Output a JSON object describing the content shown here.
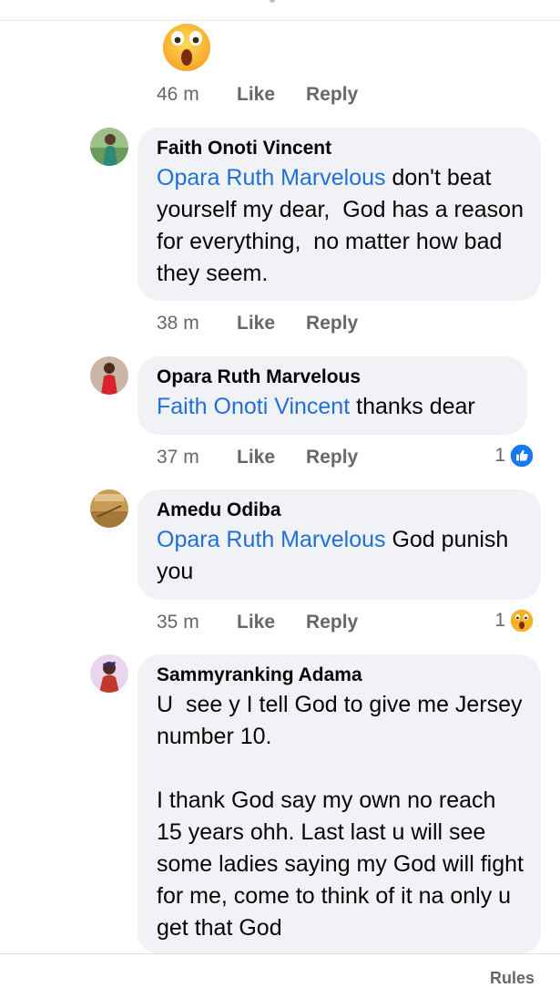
{
  "comments": [
    {
      "time": "46 m",
      "like": "Like",
      "reply": "Reply"
    },
    {
      "author": "Faith Onoti Vincent",
      "mention": "Opara Ruth Marvelous",
      "text": " don't beat yourself my dear,  God has a reason for everything,  no matter how bad they seem.",
      "time": "38 m",
      "like": "Like",
      "reply": "Reply"
    },
    {
      "author": "Opara Ruth Marvelous",
      "mention": "Faith Onoti Vincent",
      "text": " thanks dear",
      "time": "37 m",
      "like": "Like",
      "reply": "Reply",
      "reaction_count": "1",
      "reaction_icon": "like-icon"
    },
    {
      "author": "Amedu Odiba",
      "mention": "Opara Ruth Marvelous",
      "text": " God punish you",
      "time": "35 m",
      "like": "Like",
      "reply": "Reply",
      "reaction_count": "1",
      "reaction_icon": "wow-icon"
    },
    {
      "author": "Sammyranking Adama",
      "text": "U  see y I tell God to give me Jersey number 10.\n\nI thank God say my own no reach 15 years ohh. Last last u will see some ladies saying my God will fight for me, come to think of it na only u get that God"
    }
  ],
  "footer": {
    "rules": "Rules"
  },
  "colors": {
    "link": "#216fdb",
    "bubble": "#f0f2f5",
    "muted": "#65676b",
    "like_blue": "#1877f2",
    "wow_yellow": "#f7b125"
  }
}
